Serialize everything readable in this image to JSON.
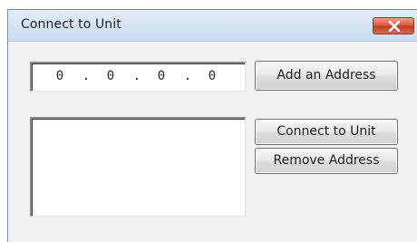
{
  "window": {
    "title": "Connect to Unit",
    "close_icon": "close-icon"
  },
  "ip_address": {
    "octet1": "0",
    "octet2": "0",
    "octet3": "0",
    "octet4": "0",
    "separator": "."
  },
  "buttons": {
    "add_address": "Add an Address",
    "connect_to_unit": "Connect to Unit",
    "remove_address": "Remove Address"
  },
  "address_list": {
    "items": []
  },
  "colors": {
    "dialog_background": "#f0f0f0",
    "close_button": "#c9452a",
    "titlebar": "#d5e4f4"
  }
}
